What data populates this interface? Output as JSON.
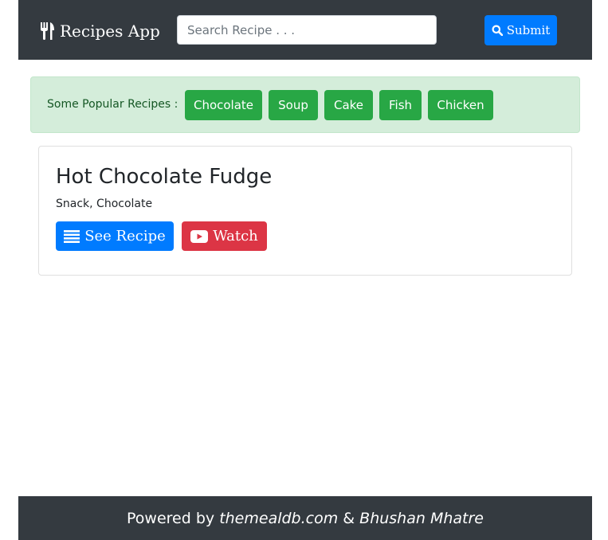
{
  "navbar": {
    "brand": "Recipes App",
    "brand_icon": "utensils-icon",
    "search_placeholder": "Search Recipe . . .",
    "search_value": "",
    "submit_label": "Submit",
    "submit_icon": "search-icon"
  },
  "popular": {
    "label": "Some Popular Recipes :",
    "items": [
      "Chocolate",
      "Soup",
      "Cake",
      "Fish",
      "Chicken"
    ]
  },
  "recipe": {
    "title": "Hot Chocolate Fudge",
    "tags": "Snack, Chocolate",
    "see_label": "See Recipe",
    "see_icon": "list-icon",
    "watch_label": "Watch",
    "watch_icon": "youtube-icon"
  },
  "footer": {
    "prefix": "Powered by",
    "source": "themealdb.com",
    "separator": "&",
    "author": "Bhushan Mhatre"
  },
  "colors": {
    "navbar_bg": "#343a40",
    "primary": "#007bff",
    "success": "#28a745",
    "danger": "#dc3545",
    "alert_bg": "#d4edda",
    "alert_text": "#155724"
  }
}
